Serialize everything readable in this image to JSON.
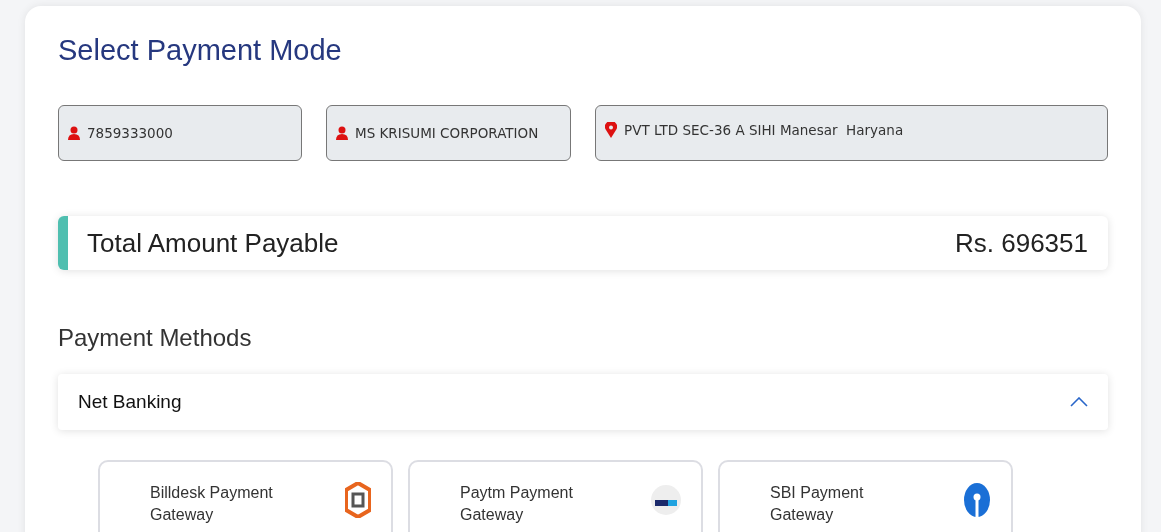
{
  "title": "Select Payment Mode",
  "fields": [
    {
      "kind": "person",
      "value": "7859333000"
    },
    {
      "kind": "person",
      "value": "MS KRISUMI CORPORATION"
    },
    {
      "kind": "location",
      "value": "PVT LTD SEC-36 A SIHI Manesar  Haryana"
    }
  ],
  "total": {
    "label": "Total Amount Payable",
    "amount": "Rs. 696351"
  },
  "section_title": "Payment Methods",
  "accordion": {
    "label": "Net Banking",
    "expanded": true
  },
  "gateways": [
    {
      "kind": "hexagon",
      "label": "Billdesk Payment Gateway"
    },
    {
      "kind": "wallet",
      "label": "Paytm Payment Gateway"
    },
    {
      "kind": "keyhole",
      "label": "SBI Payment Gateway"
    }
  ]
}
